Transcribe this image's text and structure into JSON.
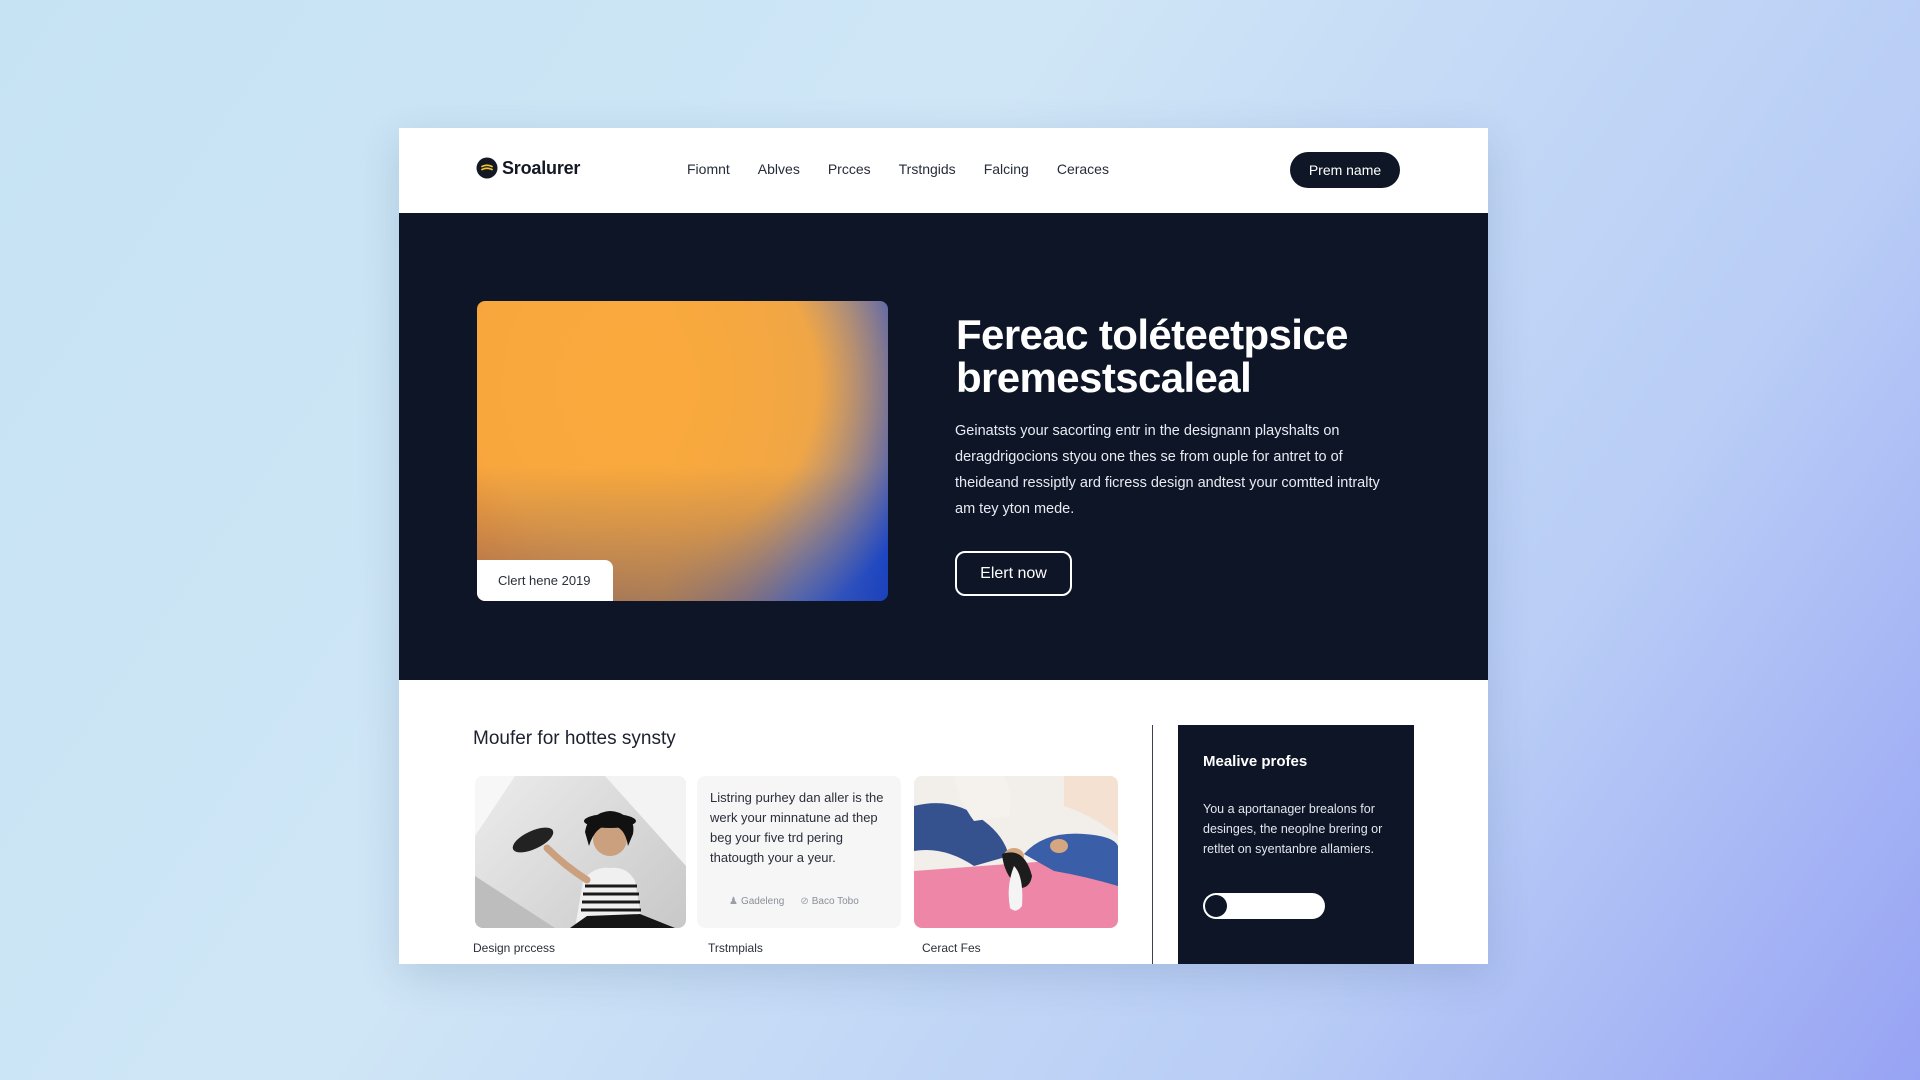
{
  "brand": {
    "name": "Sroalurer",
    "logo_icon": "brand-logo-icon"
  },
  "nav": {
    "links": [
      "Fiomnt",
      "Ablves",
      "Prcces",
      "Trstngids",
      "Falcing",
      "Ceraces"
    ],
    "cta_label": "Prem name"
  },
  "hero": {
    "image_tag": "Clert hene 2019",
    "title": "Fereac toléteetpsice bremestscaleal",
    "text": "Geinatsts your sacorting entr in the designann playshalts on deragdrigocions styou one thes se from ouple for antret to of theideand ressiptly ard ficress design andtest your comtted intralty am tey yton mede.",
    "button_label": "Elert now"
  },
  "section": {
    "title": "Moufer for hottes synsty",
    "cards": [
      {
        "caption": "Design prccess"
      },
      {
        "quote": "Listring purhey dan aller is the werk your minnatune ad thep beg your five trd pering thatougth your a yeur.",
        "meta": [
          "Gadeleng",
          "Baco Tobo"
        ],
        "caption": "Trstmpials"
      },
      {
        "caption": "Ceract Fes"
      }
    ]
  },
  "side_panel": {
    "title": "Mealive profes",
    "text": "You a aportanager brealons for desinges, the neoplne brering or retltet on syentanbre allamiers."
  },
  "colors": {
    "dark_navy": "#0d1526",
    "gradient_orange": "#f7a83e",
    "gradient_blue": "#1f4ed3",
    "page_background": "#c6e3f4"
  }
}
